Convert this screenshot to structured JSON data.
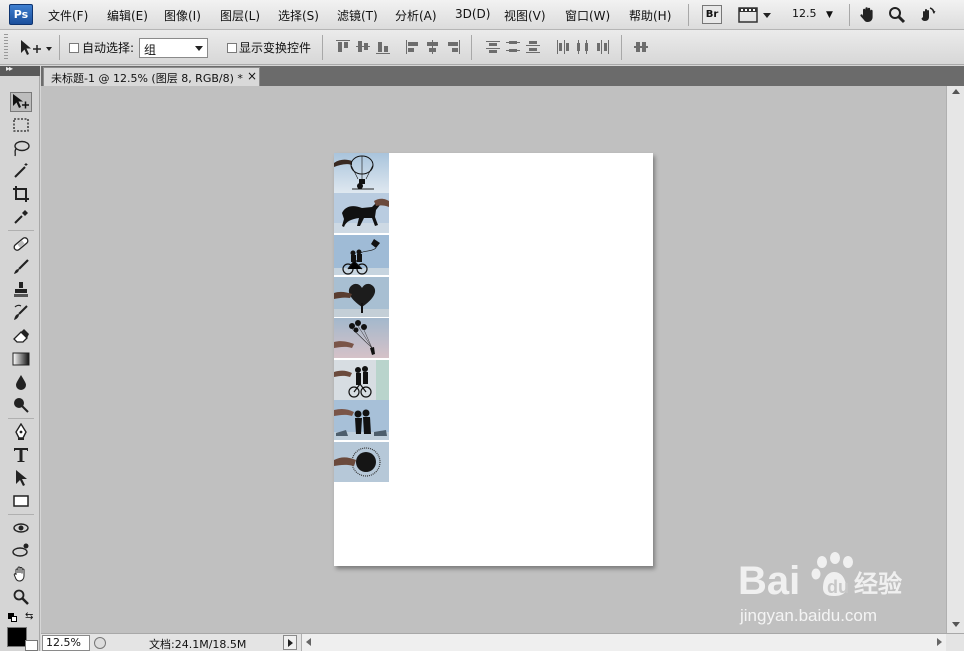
{
  "app": {
    "logo": "Ps"
  },
  "menubar": {
    "items": [
      "文件(F)",
      "编辑(E)",
      "图像(I)",
      "图层(L)",
      "选择(S)",
      "滤镜(T)",
      "分析(A)",
      "3D(D)",
      "视图(V)",
      "窗口(W)",
      "帮助(H)"
    ],
    "bridge_label": "Br",
    "zoom": "12.5"
  },
  "options": {
    "auto_select_label": "自动选择:",
    "auto_select_value": "组",
    "show_transform_label": "显示变换控件"
  },
  "document": {
    "tab_title": "未标题-1 @ 12.5% (图层 8, RGB/8) *",
    "close_glyph": "×"
  },
  "thumbnails": [
    "hot-air-balloon",
    "horse",
    "bicycle-kite",
    "heart-tree",
    "balloons",
    "kiss-bicycle",
    "couple-kiss",
    "round-photo"
  ],
  "status": {
    "zoom": "12.5%",
    "doc_size": "文档:24.1M/18.5M"
  },
  "watermark": {
    "logo_text": "Bai",
    "brand_text": "经验",
    "url": "jingyan.baidu.com"
  },
  "colors": {
    "foreground": "#000000",
    "background": "#ffffff",
    "workspace": "#c0c0c0"
  }
}
